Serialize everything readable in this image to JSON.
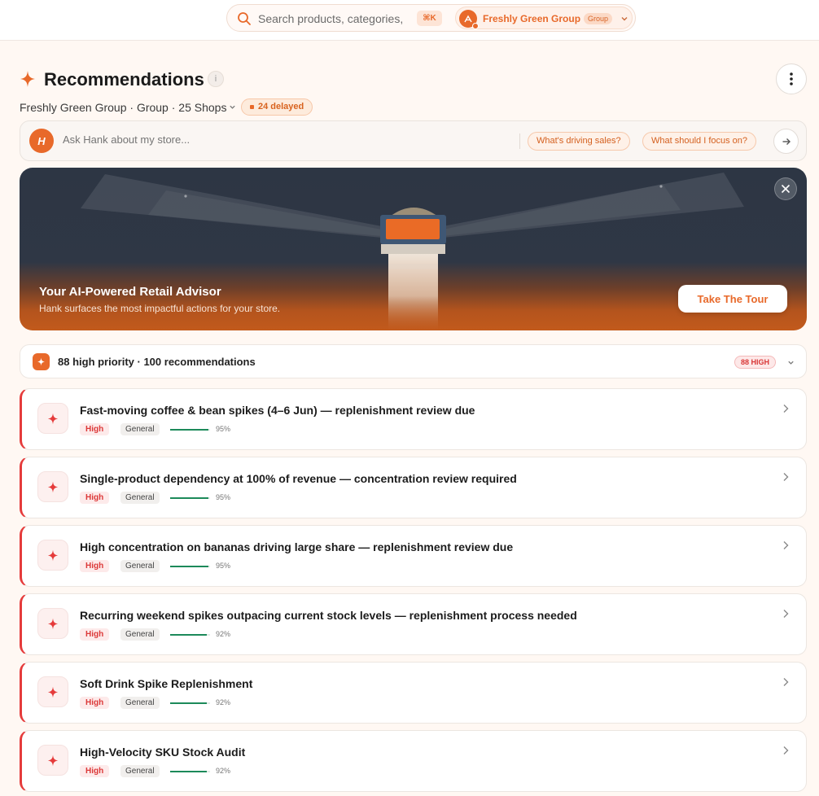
{
  "search": {
    "placeholder": "Search products, categories,",
    "shortcut": "⌘K"
  },
  "org": {
    "name": "Freshly Green Group",
    "tag": "Group"
  },
  "header": {
    "title": "Recommendations",
    "subline": "Freshly Green Group · Group · 25 Shops",
    "delayed": "24 delayed"
  },
  "ask": {
    "avatar_letter": "H",
    "placeholder": "Ask Hank about my store...",
    "chips": [
      "What's driving sales?",
      "What should I focus on?"
    ]
  },
  "hero": {
    "title": "Your AI-Powered Retail Advisor",
    "subtitle": "Hank surfaces the most impactful actions for your store.",
    "cta": "Take The Tour"
  },
  "summary": {
    "text": "88 high priority · 100 recommendations",
    "badge": "88 HIGH"
  },
  "recommendations": [
    {
      "title": "Fast-moving coffee & bean spikes (4–6 Jun) — replenishment review due",
      "priority": "High",
      "category": "General",
      "confidence": "95%",
      "confidence_value": 0.95
    },
    {
      "title": "Single-product dependency at 100% of revenue — concentration review required",
      "priority": "High",
      "category": "General",
      "confidence": "95%",
      "confidence_value": 0.95
    },
    {
      "title": "High concentration on bananas driving large share — replenishment review due",
      "priority": "High",
      "category": "General",
      "confidence": "95%",
      "confidence_value": 0.95
    },
    {
      "title": "Recurring weekend spikes outpacing current stock levels — replenishment process needed",
      "priority": "High",
      "category": "General",
      "confidence": "92%",
      "confidence_value": 0.92
    },
    {
      "title": "Soft Drink Spike Replenishment",
      "priority": "High",
      "category": "General",
      "confidence": "92%",
      "confidence_value": 0.92
    },
    {
      "title": "High-Velocity SKU Stock Audit",
      "priority": "High",
      "category": "General",
      "confidence": "92%",
      "confidence_value": 0.92
    }
  ],
  "colors": {
    "accent": "#e8692a",
    "high": "#e53b3b",
    "confidence_bar": "#1c8a5a",
    "page_bg": "#fff8f3"
  },
  "icons": {
    "search": "search-icon",
    "title": "sparkle-icon",
    "info": "info-icon",
    "more": "more-vertical-icon",
    "send": "arrow-right-icon",
    "close": "close-icon",
    "chevron": "chevron-right-icon"
  }
}
